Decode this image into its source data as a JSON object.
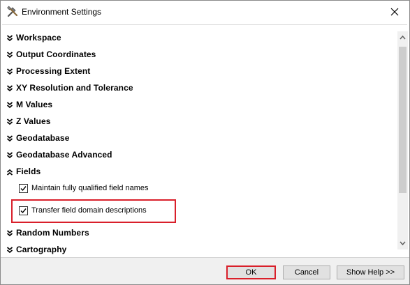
{
  "window": {
    "title": "Environment Settings"
  },
  "sections": [
    {
      "label": "Workspace",
      "expanded": false
    },
    {
      "label": "Output Coordinates",
      "expanded": false
    },
    {
      "label": "Processing Extent",
      "expanded": false
    },
    {
      "label": "XY Resolution and Tolerance",
      "expanded": false
    },
    {
      "label": "M Values",
      "expanded": false
    },
    {
      "label": "Z Values",
      "expanded": false
    },
    {
      "label": "Geodatabase",
      "expanded": false
    },
    {
      "label": "Geodatabase Advanced",
      "expanded": false
    },
    {
      "label": "Fields",
      "expanded": true
    },
    {
      "label": "Random Numbers",
      "expanded": false
    },
    {
      "label": "Cartography",
      "expanded": false
    }
  ],
  "fields_options": [
    {
      "label": "Maintain fully qualified field names",
      "checked": true
    },
    {
      "label": "Transfer field domain descriptions",
      "checked": true
    }
  ],
  "buttons": {
    "ok": "OK",
    "cancel": "Cancel",
    "show_help": "Show Help >>"
  },
  "colors": {
    "highlight": "#d91f2a",
    "footer_bg": "#f0f0f0",
    "button_bg": "#e1e1e1"
  },
  "icons": {
    "title": "tools-icon",
    "close": "close-icon",
    "collapsed": "double-chevron-down-icon",
    "expanded": "double-chevron-up-icon"
  }
}
